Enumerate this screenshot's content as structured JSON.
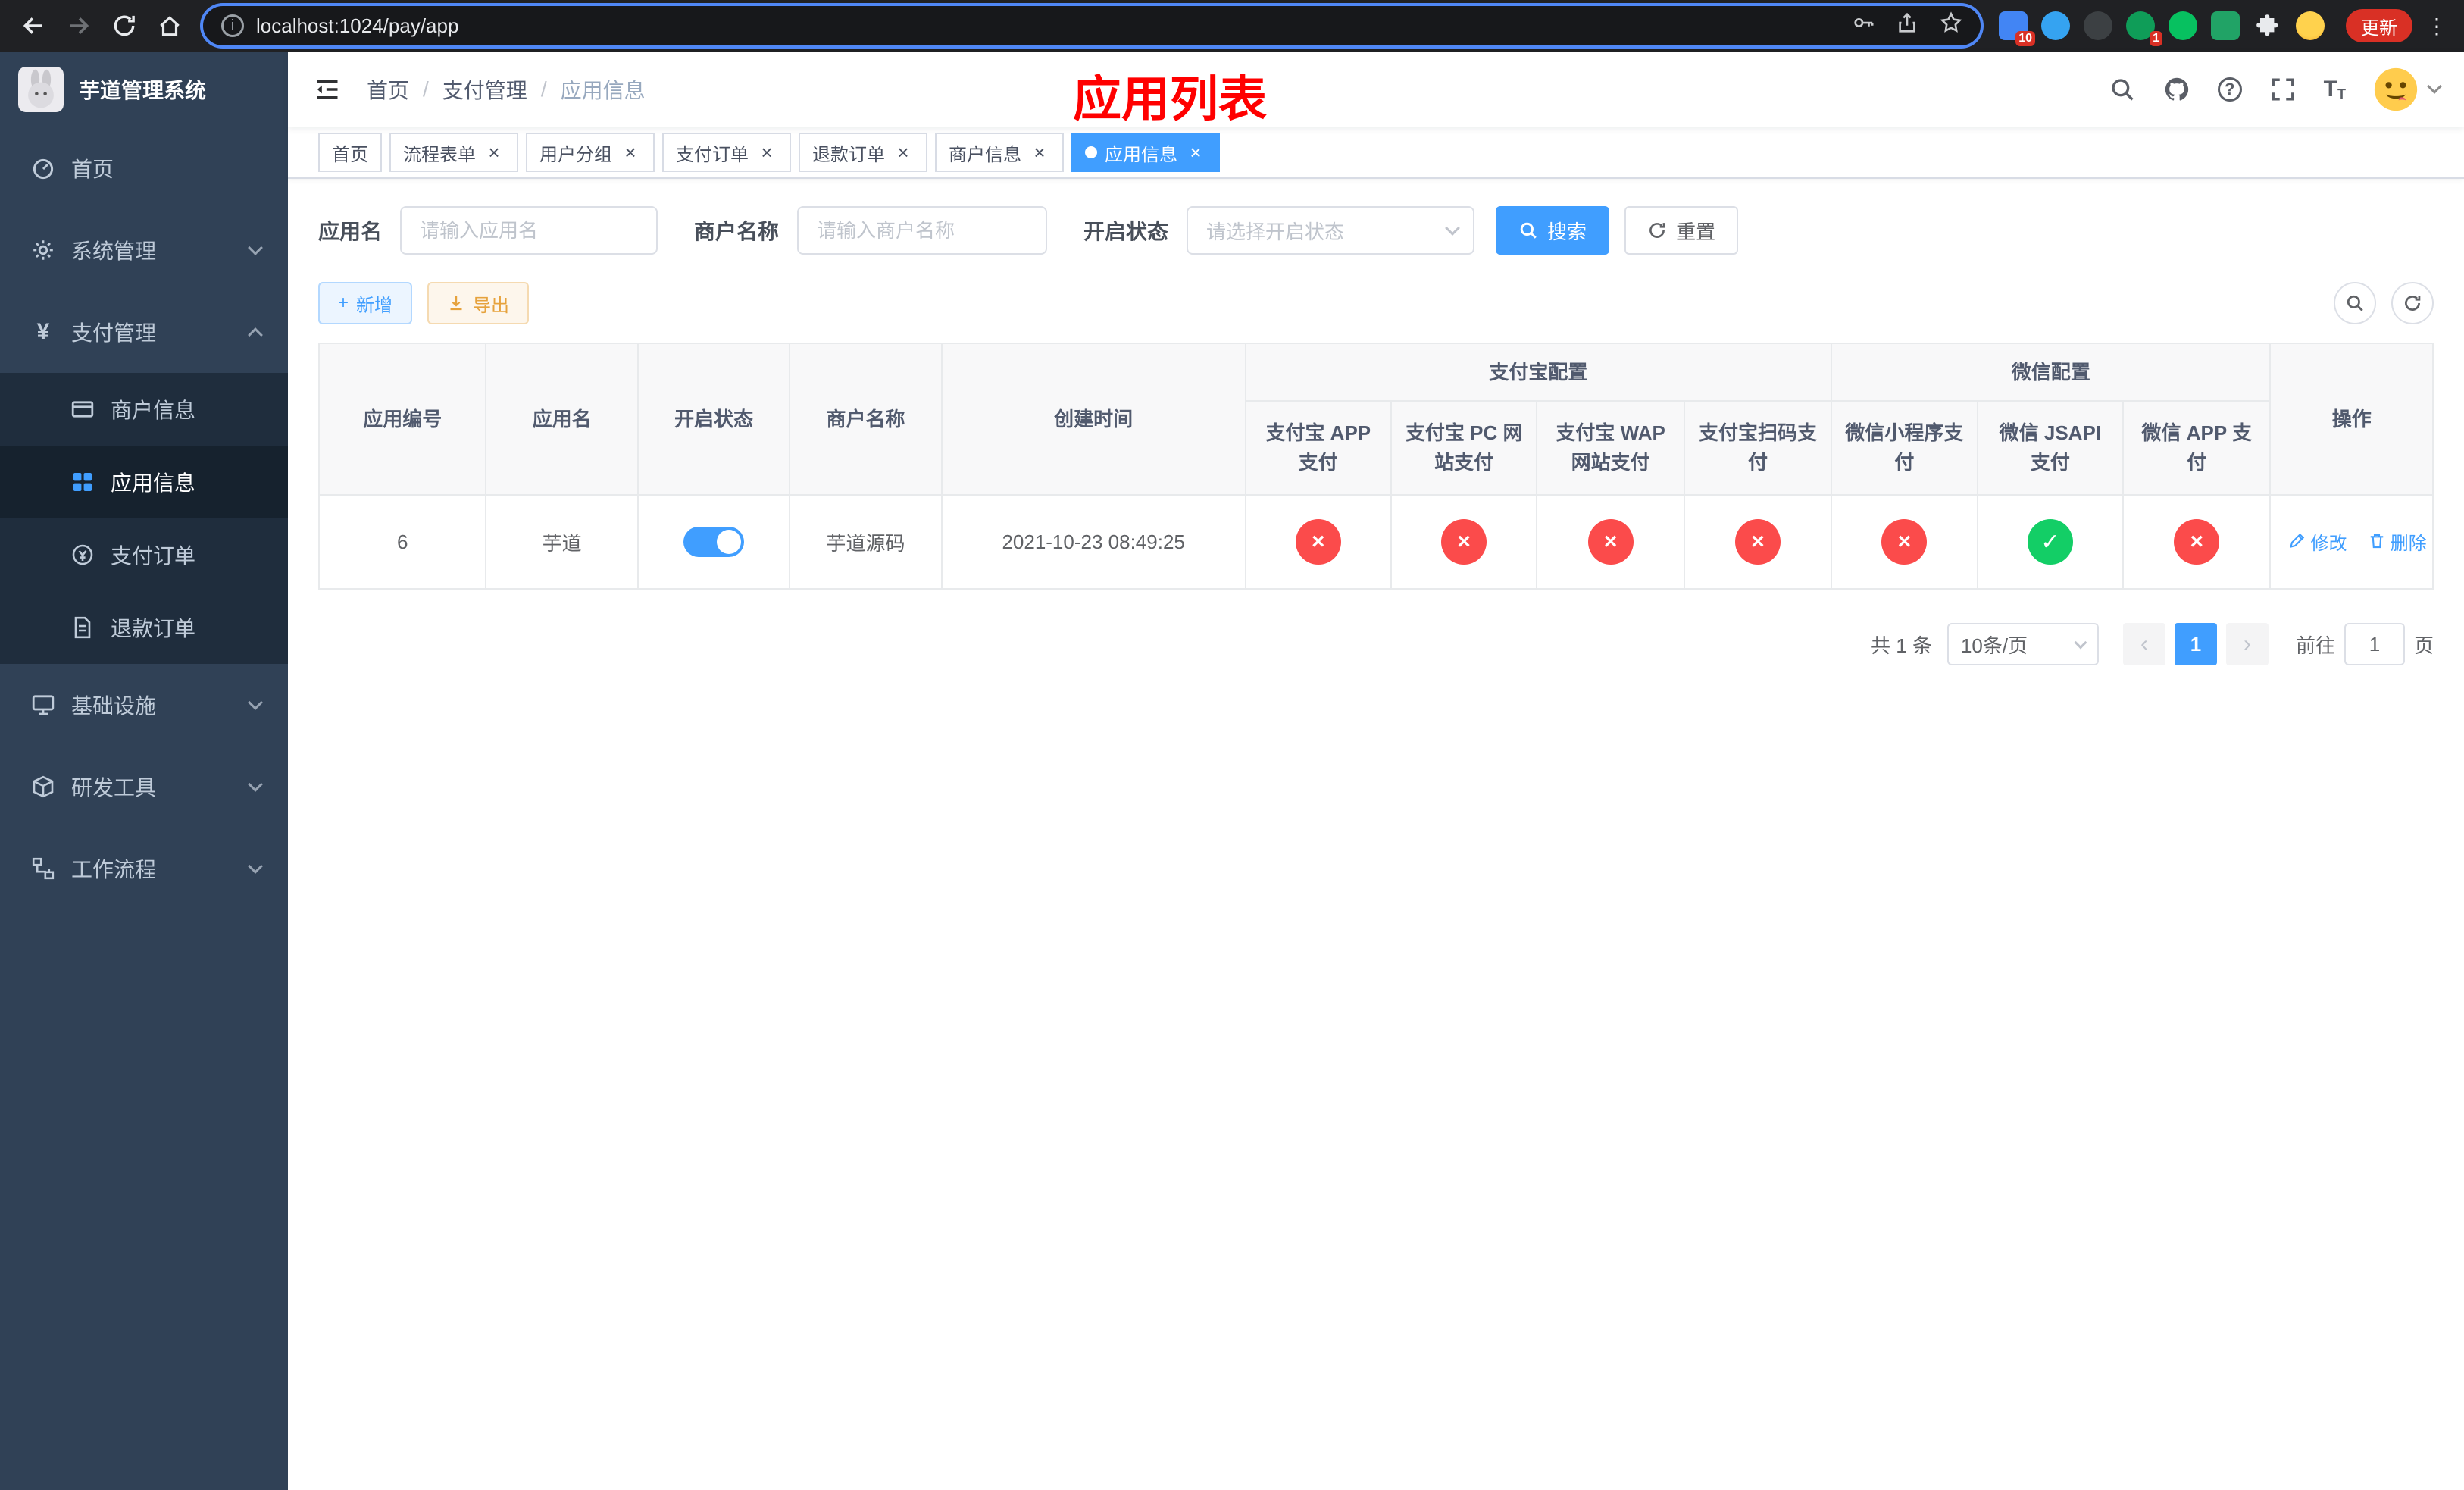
{
  "browser": {
    "url": "localhost:1024/pay/app",
    "update_label": "更新",
    "ext_badge_blue": "10",
    "ext_badge_green": "1"
  },
  "annotation": {
    "title": "应用列表",
    "color": "#ff0000"
  },
  "sidebar": {
    "app_title": "芋道管理系统",
    "menu": [
      {
        "label": "首页"
      },
      {
        "label": "系统管理"
      },
      {
        "label": "支付管理"
      },
      {
        "label": "基础设施"
      },
      {
        "label": "研发工具"
      },
      {
        "label": "工作流程"
      }
    ],
    "submenu": [
      {
        "label": "商户信息"
      },
      {
        "label": "应用信息"
      },
      {
        "label": "支付订单"
      },
      {
        "label": "退款订单"
      }
    ]
  },
  "navbar": {
    "breadcrumb": [
      "首页",
      "支付管理",
      "应用信息"
    ]
  },
  "tags": [
    {
      "label": "首页"
    },
    {
      "label": "流程表单"
    },
    {
      "label": "用户分组"
    },
    {
      "label": "支付订单"
    },
    {
      "label": "退款订单"
    },
    {
      "label": "商户信息"
    },
    {
      "label": "应用信息"
    }
  ],
  "search_form": {
    "app_name_label": "应用名",
    "app_name_placeholder": "请输入应用名",
    "merchant_label": "商户名称",
    "merchant_placeholder": "请输入商户名称",
    "status_label": "开启状态",
    "status_placeholder": "请选择开启状态",
    "search_button": "搜索",
    "reset_button": "重置"
  },
  "toolbar": {
    "add_label": "新增",
    "export_label": "导出"
  },
  "table": {
    "headers": {
      "app_id": "应用编号",
      "app_name": "应用名",
      "status": "开启状态",
      "merchant": "商户名称",
      "create_time": "创建时间",
      "alipay_group": "支付宝配置",
      "wechat_group": "微信配置",
      "alipay_app": "支付宝 APP 支付",
      "alipay_pc": "支付宝 PC 网站支付",
      "alipay_wap": "支付宝 WAP 网站支付",
      "alipay_qr": "支付宝扫码支付",
      "wx_mini": "微信小程序支付",
      "wx_jsapi": "微信 JSAPI 支付",
      "wx_app": "微信 APP 支付",
      "actions": "操作"
    },
    "rows": [
      {
        "app_id": "6",
        "app_name": "芋道",
        "status_on": true,
        "merchant": "芋道源码",
        "create_time": "2021-10-23 08:49:25",
        "configs": [
          "no",
          "no",
          "no",
          "no",
          "no",
          "yes",
          "no"
        ],
        "edit_label": "修改",
        "delete_label": "删除"
      }
    ]
  },
  "pagination": {
    "total_text": "共 1 条",
    "page_size": "10条/页",
    "current_page": "1",
    "goto_prefix": "前往",
    "goto_value": "1",
    "goto_suffix": "页"
  },
  "icons": {
    "check_glyph": "✓",
    "cross_glyph": "×"
  },
  "colors": {
    "primary": "#409eff",
    "success": "#13ce66",
    "danger": "#fb4b4b",
    "warning": "#e6a23c",
    "sidebar_bg": "#304156",
    "submenu_bg": "#1f2d3d",
    "annotation": "#ff0000"
  }
}
